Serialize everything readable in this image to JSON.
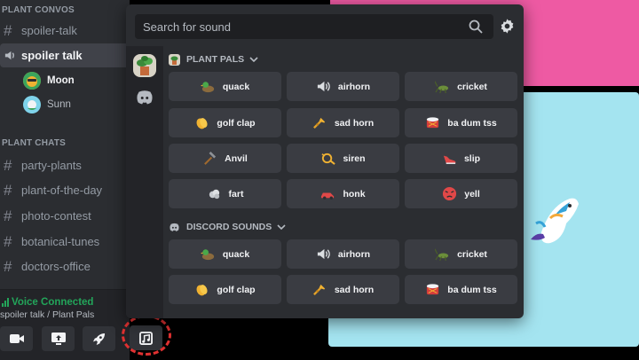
{
  "channels": {
    "category_convos": "PLANT CONVOS",
    "convos": [
      {
        "name": "spoiler-talk",
        "type": "text"
      },
      {
        "name": "spoiler talk",
        "type": "voice"
      }
    ],
    "voice_users": [
      "Moon",
      "Sunn"
    ],
    "category_chats": "PLANT CHATS",
    "chats": [
      "party-plants",
      "plant-of-the-day",
      "photo-contest",
      "botanical-tunes",
      "doctors-office"
    ]
  },
  "voice_panel": {
    "status": "Voice Connected",
    "location": "spoiler talk / Plant Pals",
    "buttons": [
      "camera-icon",
      "screen-share-icon",
      "activity-rocket-icon",
      "soundboard-icon"
    ]
  },
  "soundboard": {
    "search_placeholder": "Search for sound",
    "sections": [
      {
        "title": "PLANT PALS",
        "sounds": [
          {
            "label": "quack",
            "icon": "duck-icon"
          },
          {
            "label": "airhorn",
            "icon": "speaker-icon"
          },
          {
            "label": "cricket",
            "icon": "cricket-icon"
          },
          {
            "label": "golf clap",
            "icon": "clap-icon"
          },
          {
            "label": "sad horn",
            "icon": "trumpet-icon"
          },
          {
            "label": "ba dum tss",
            "icon": "drum-icon"
          },
          {
            "label": "Anvil",
            "icon": "hammer-icon"
          },
          {
            "label": "siren",
            "icon": "horn-icon"
          },
          {
            "label": "slip",
            "icon": "shoe-icon"
          },
          {
            "label": "fart",
            "icon": "cloud-icon"
          },
          {
            "label": "honk",
            "icon": "car-icon"
          },
          {
            "label": "yell",
            "icon": "angry-face-icon"
          }
        ]
      },
      {
        "title": "DISCORD SOUNDS",
        "sounds": [
          {
            "label": "quack",
            "icon": "duck-icon"
          },
          {
            "label": "airhorn",
            "icon": "speaker-icon"
          },
          {
            "label": "cricket",
            "icon": "cricket-icon"
          },
          {
            "label": "golf clap",
            "icon": "clap-icon"
          },
          {
            "label": "sad horn",
            "icon": "trumpet-icon"
          },
          {
            "label": "ba dum tss",
            "icon": "drum-icon"
          }
        ]
      }
    ]
  },
  "colors": {
    "voice_connected": "#23a55a",
    "highlight_ring": "#e03131",
    "tile_pink": "#ee5aa3",
    "tile_blue": "#a4e4f0"
  }
}
